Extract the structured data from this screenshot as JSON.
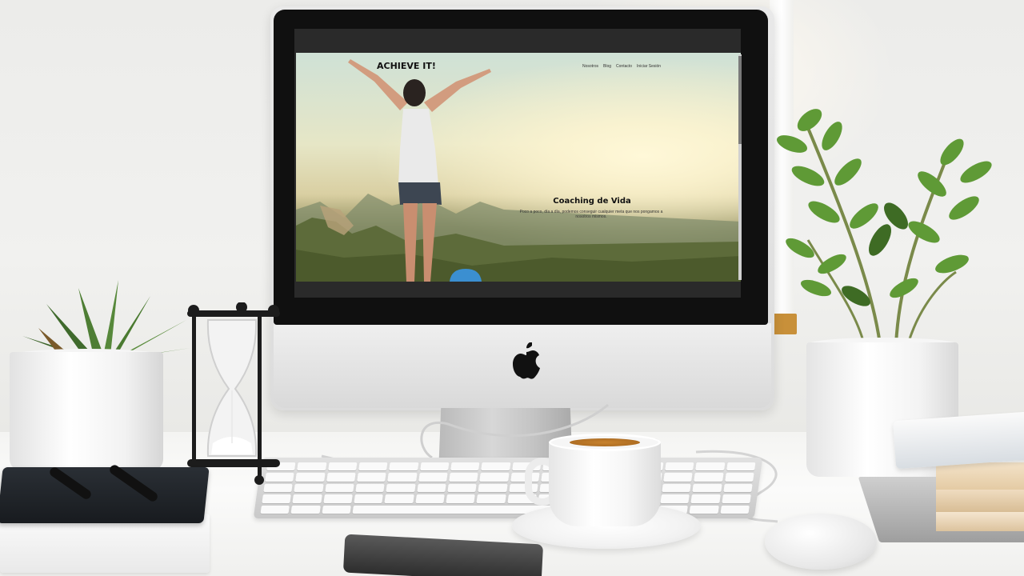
{
  "website": {
    "logo": "ACHIEVE IT!",
    "nav": [
      "Nosotros",
      "Blog",
      "Contacto",
      "Iniciar Sesión"
    ],
    "heading": "Coaching de Vida",
    "subtitle": "Poco a poco, día a día, podemos conseguir cualquier meta que nos pongamos a nosotros mismos."
  },
  "objects": {
    "monitor_logo": "apple-icon"
  }
}
